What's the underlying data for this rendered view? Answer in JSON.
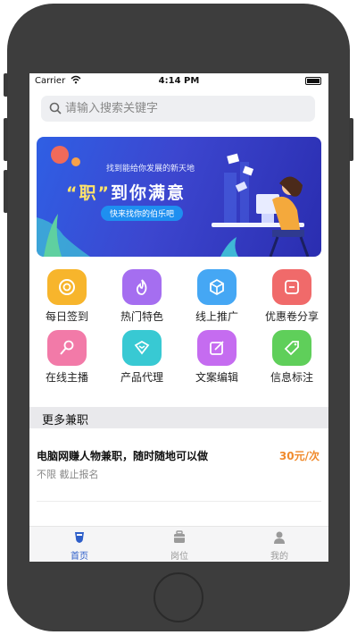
{
  "status_bar": {
    "carrier": "Carrier",
    "time": "4:14 PM"
  },
  "search": {
    "placeholder": "请输入搜索关键字"
  },
  "banner": {
    "subtitle": "找到能给你发展的新天地",
    "title_highlight": "“职”",
    "title_rest": "到你满意",
    "pill": "快来找你的伯乐吧"
  },
  "grid": {
    "items": [
      {
        "label": "每日签到",
        "icon": "coin-icon",
        "color": "#f7b52c"
      },
      {
        "label": "热门特色",
        "icon": "flame-icon",
        "color": "#a56ef0"
      },
      {
        "label": "线上推广",
        "icon": "cube-icon",
        "color": "#45a7f4"
      },
      {
        "label": "优惠卷分享",
        "icon": "coupon-icon",
        "color": "#f06a6a"
      },
      {
        "label": "在线主播",
        "icon": "microphone-icon",
        "color": "#f27aa8"
      },
      {
        "label": "产品代理",
        "icon": "diamond-icon",
        "color": "#38c9d3"
      },
      {
        "label": "文案编辑",
        "icon": "edit-icon",
        "color": "#c56cf0"
      },
      {
        "label": "信息标注",
        "icon": "tag-icon",
        "color": "#5fcf5a"
      }
    ]
  },
  "section": {
    "title": "更多兼职"
  },
  "jobs": [
    {
      "title": "电脑网赚人物兼职，随时随地可以做",
      "meta": "不限 截止报名",
      "price": "30元/次"
    }
  ],
  "tabbar": {
    "items": [
      {
        "label": "首页",
        "icon": "home-icon",
        "active": true
      },
      {
        "label": "岗位",
        "icon": "briefcase-icon",
        "active": false
      },
      {
        "label": "我的",
        "icon": "user-icon",
        "active": false
      }
    ]
  }
}
